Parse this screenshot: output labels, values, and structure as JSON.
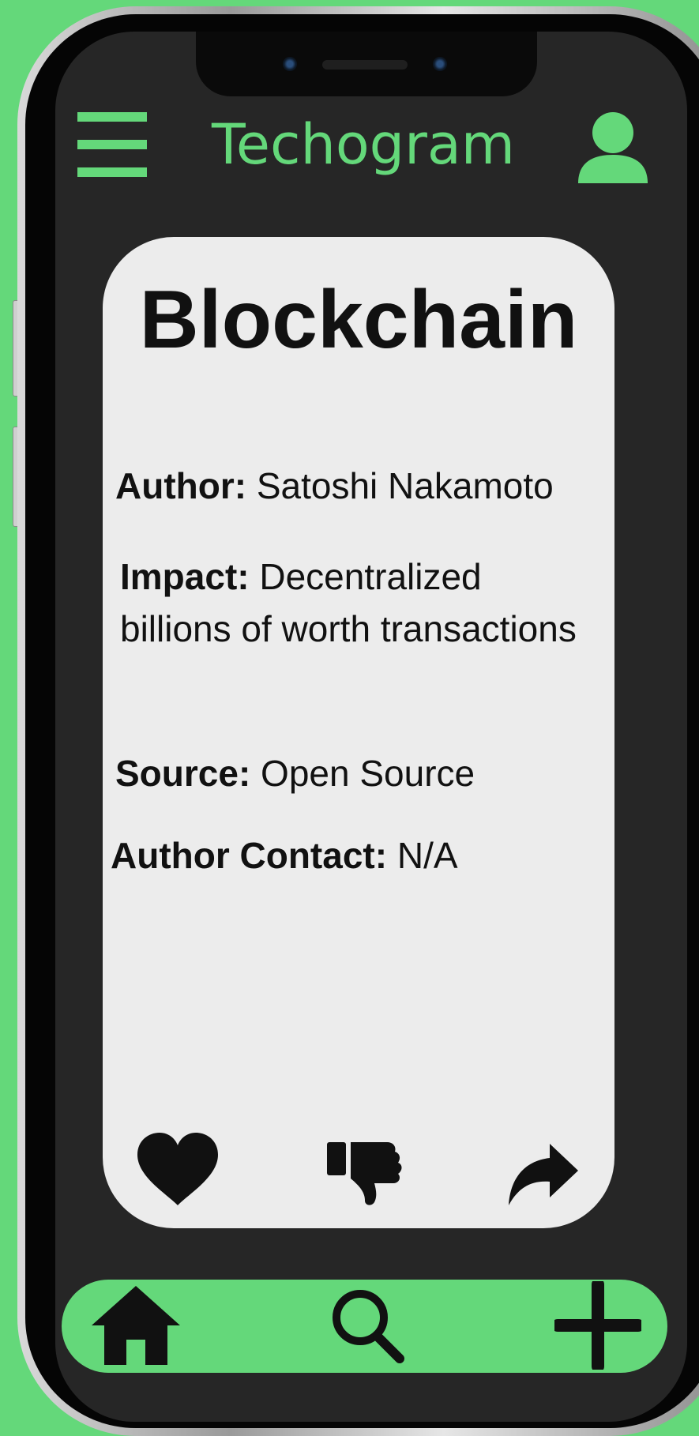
{
  "app": {
    "title": "Techogram"
  },
  "post": {
    "title": "Blockchain",
    "fields": [
      {
        "label": "Author:",
        "value": "Satoshi Nakamoto"
      },
      {
        "label": "Impact:",
        "value": "Decentralized billions of worth transactions"
      },
      {
        "label": "Source:",
        "value": "Open Source"
      },
      {
        "label": "Author Contact:",
        "value": "N/A"
      }
    ],
    "actions": [
      "heart-icon",
      "thumbs-down-icon",
      "share-icon"
    ]
  },
  "bottom_nav": {
    "items": [
      "home-icon",
      "search-icon",
      "plus-icon"
    ]
  },
  "colors": {
    "accent": "#64d87a",
    "screen": "#262626",
    "card": "#ececec",
    "text": "#111111"
  }
}
